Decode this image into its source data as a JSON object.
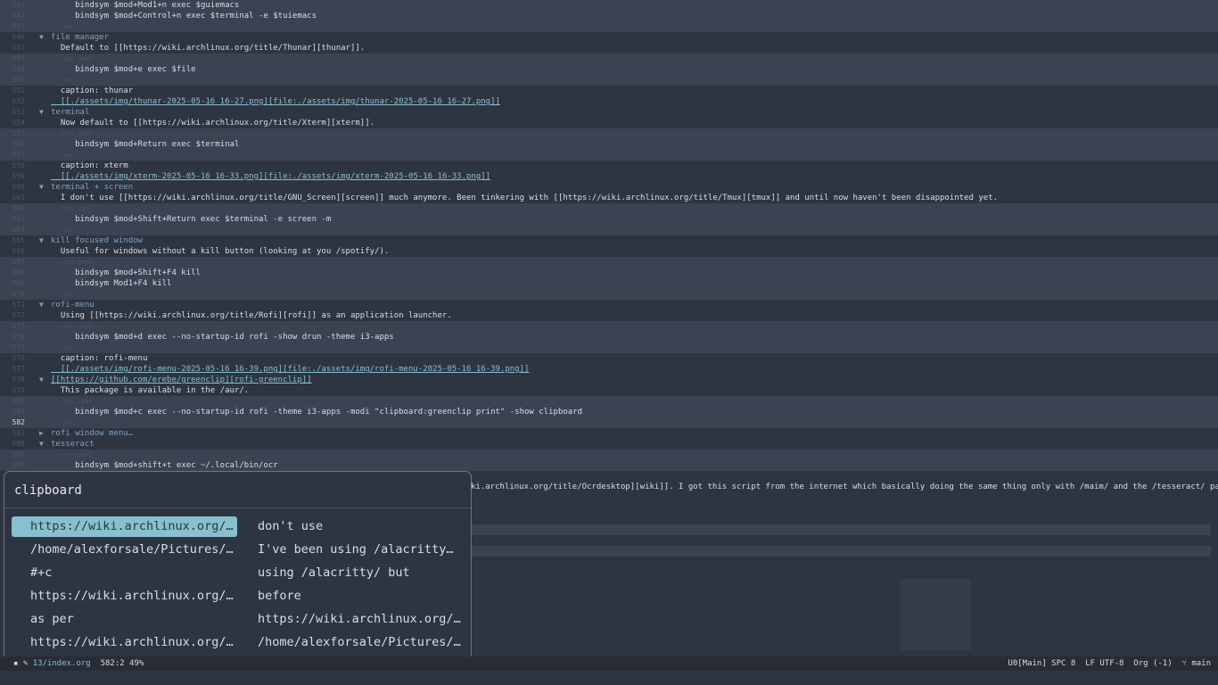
{
  "editor": {
    "lines": [
      {
        "n": "543",
        "k": "blk",
        "fold": "",
        "t": "     bindsym $mod+Mod1+n exec $guiemacs",
        "c": "body"
      },
      {
        "n": "544",
        "k": "blk",
        "fold": "",
        "t": "     bindsym $mod+Control+n exec $terminal -e $tuiemacs",
        "c": "body"
      },
      {
        "n": "545",
        "k": "blk",
        "fold": "",
        "t": "   src",
        "c": "meta"
      },
      {
        "n": "546",
        "k": "",
        "fold": "▼",
        "t": "file manager",
        "c": "head"
      },
      {
        "n": "547",
        "k": "",
        "fold": "",
        "t": "  Default to [[https://wiki.archlinux.org/title/Thunar][thunar]].",
        "c": "body"
      },
      {
        "n": "548",
        "k": "blk",
        "fold": "",
        "t": "   src conf",
        "c": "meta"
      },
      {
        "n": "549",
        "k": "blk",
        "fold": "",
        "t": "     bindsym $mod+e exec $file",
        "c": "body"
      },
      {
        "n": "550",
        "k": "blk",
        "fold": "",
        "t": "   src",
        "c": "meta"
      },
      {
        "n": "551",
        "k": "",
        "fold": "",
        "t": "  caption: thunar",
        "c": "cap"
      },
      {
        "n": "552",
        "k": "",
        "fold": "",
        "t": "  [[./assets/img/thunar-2025-05-16_16-27.png][file:./assets/img/thunar-2025-05-16_16-27.png]]",
        "c": "link"
      },
      {
        "n": "553",
        "k": "",
        "fold": "▼",
        "t": "terminal",
        "c": "head"
      },
      {
        "n": "554",
        "k": "",
        "fold": "",
        "t": "  Now default to [[https://wiki.archlinux.org/title/Xterm][xterm]].",
        "c": "body"
      },
      {
        "n": "555",
        "k": "blk",
        "fold": "",
        "t": "   src conf",
        "c": "meta"
      },
      {
        "n": "556",
        "k": "blk",
        "fold": "",
        "t": "     bindsym $mod+Return exec $terminal",
        "c": "body"
      },
      {
        "n": "557",
        "k": "blk",
        "fold": "",
        "t": "   src",
        "c": "meta"
      },
      {
        "n": "558",
        "k": "",
        "fold": "",
        "t": "  caption: xterm",
        "c": "cap"
      },
      {
        "n": "559",
        "k": "",
        "fold": "",
        "t": "  [[./assets/img/xterm-2025-05-16_16-33.png][file:./assets/img/xterm-2025-05-16_16-33.png]]",
        "c": "link"
      },
      {
        "n": "560",
        "k": "",
        "fold": "▼",
        "t": "terminal + screen",
        "c": "head"
      },
      {
        "n": "561",
        "k": "",
        "fold": "",
        "t": "  I don't use [[https://wiki.archlinux.org/title/GNU_Screen][screen]] much anymore. Been tinkering with [[https://wiki.archlinux.org/title/Tmux][tmux]] and until now haven't been disappointed yet.",
        "c": "body"
      },
      {
        "n": "562",
        "k": "blk",
        "fold": "",
        "t": "   src conf",
        "c": "meta"
      },
      {
        "n": "563",
        "k": "blk",
        "fold": "",
        "t": "     bindsym $mod+Shift+Return exec $terminal -e screen -m",
        "c": "body"
      },
      {
        "n": "564",
        "k": "blk",
        "fold": "",
        "t": "   src",
        "c": "meta"
      },
      {
        "n": "565",
        "k": "",
        "fold": "▼",
        "t": "kill focused window",
        "c": "head"
      },
      {
        "n": "566",
        "k": "",
        "fold": "",
        "t": "  Useful for windows without a kill button (looking at you /spotify/).",
        "c": "body"
      },
      {
        "n": "567",
        "k": "blk",
        "fold": "",
        "t": "   src conf",
        "c": "meta"
      },
      {
        "n": "568",
        "k": "blk",
        "fold": "",
        "t": "     bindsym $mod+Shift+F4 kill",
        "c": "body"
      },
      {
        "n": "569",
        "k": "blk",
        "fold": "",
        "t": "     bindsym Mod1+F4 kill",
        "c": "body"
      },
      {
        "n": "570",
        "k": "blk",
        "fold": "",
        "t": "   src",
        "c": "meta"
      },
      {
        "n": "571",
        "k": "",
        "fold": "▼",
        "t": "rofi-menu",
        "c": "head"
      },
      {
        "n": "572",
        "k": "",
        "fold": "",
        "t": "  Using [[https://wiki.archlinux.org/title/Rofi][rofi]] as an application launcher.",
        "c": "body"
      },
      {
        "n": "573",
        "k": "blk",
        "fold": "",
        "t": "   src conf",
        "c": "meta"
      },
      {
        "n": "574",
        "k": "blk",
        "fold": "",
        "t": "     bindsym $mod+d exec --no-startup-id rofi -show drun -theme i3-apps",
        "c": "body"
      },
      {
        "n": "575",
        "k": "blk",
        "fold": "",
        "t": "   src",
        "c": "meta"
      },
      {
        "n": "576",
        "k": "",
        "fold": "",
        "t": "  caption: rofi-menu",
        "c": "cap"
      },
      {
        "n": "577",
        "k": "",
        "fold": "",
        "t": "  [[./assets/img/rofi-menu-2025-05-16_16-39.png][file:./assets/img/rofi-menu-2025-05-16_16-39.png]]",
        "c": "link"
      },
      {
        "n": "578",
        "k": "",
        "fold": "▼",
        "t": "[[https://github.com/erebe/greenclip][rofi-greenclip]]",
        "c": "linkhead"
      },
      {
        "n": "579",
        "k": "",
        "fold": "",
        "t": "  This package is available in the /aur/.",
        "c": "body"
      },
      {
        "n": "580",
        "k": "blk",
        "fold": "",
        "t": "   src conf",
        "c": "meta"
      },
      {
        "n": "581",
        "k": "blk",
        "fold": "",
        "t": "     bindsym $mod+c exec --no-startup-id rofi -theme i3-apps -modi \"clipboard:greenclip print\" -show clipboard",
        "c": "body"
      },
      {
        "n": "582",
        "k": "cur",
        "fold": "",
        "t": "   src",
        "c": "meta"
      },
      {
        "n": "583",
        "k": "",
        "fold": "▶",
        "t": "rofi window menu…",
        "c": "head"
      },
      {
        "n": "588",
        "k": "",
        "fold": "▼",
        "t": "tesseract",
        "c": "head"
      },
      {
        "n": "589",
        "k": "blk",
        "fold": "",
        "t": "   src conf",
        "c": "meta"
      },
      {
        "n": "590",
        "k": "blk",
        "fold": "",
        "t": "     bindsym $mod+shift+t exec ~/.local/bin/ocr",
        "c": "body"
      }
    ],
    "overflow_text": "ki.archlinux.org/title/Ocrdesktop][wiki]]. I got this script from the internet which basically doing the same thing only with /maim/ and the /tesseract/ package."
  },
  "popup": {
    "input_value": "clipboard",
    "left_options": [
      "https://wiki.archlinux.org/…",
      "/home/alexforsale/Pictures/…",
      "#+c",
      "https://wiki.archlinux.org/…",
      "as per",
      "https://wiki.archlinux.org/…"
    ],
    "right_options": [
      "don't use",
      "I've been using /alacritty…",
      "using /alacritty/ but",
      "before",
      "https://wiki.archlinux.org/…",
      "/home/alexforsale/Pictures/…"
    ],
    "selected_index": 0
  },
  "modeline": {
    "file": "13/index.org",
    "position": "582:2 49%",
    "right": "U0[Main] SPC 8  LF UTF-8  Org (-1)  ",
    "branch": "main"
  },
  "colors": {
    "background": "#2e3440",
    "accent": "#88c0d0",
    "heading": "#81a1c1",
    "string": "#a3be8c"
  }
}
